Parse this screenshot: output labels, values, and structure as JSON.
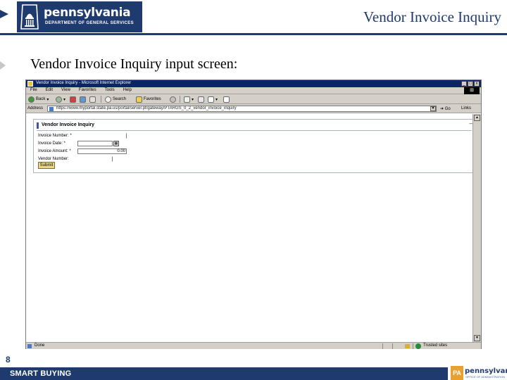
{
  "slide": {
    "logo_word": "pennsylvania",
    "logo_sub": "DEPARTMENT OF GENERAL SERVICES",
    "header_title": "Vendor Invoice Inquiry",
    "subtitle": "Vendor Invoice Inquiry input screen:",
    "page_number": "8",
    "footer_text": "SMART BUYING",
    "footer_logo_mark": "PA",
    "footer_logo_word": "pennsylvania",
    "footer_logo_sub": "OFFICE OF ADMINISTRATION",
    "brand_color": "#1f3a6e"
  },
  "browser": {
    "window_title": "Vendor Invoice Inquiry - Microsoft Internet Explorer",
    "window_buttons": [
      "_",
      "□",
      "x"
    ],
    "menu": [
      "File",
      "Edit",
      "View",
      "Favorites",
      "Tools",
      "Help"
    ],
    "toolbar": {
      "back": "Back",
      "search": "Search",
      "favorites": "Favorites"
    },
    "address_label": "Address",
    "address_url": "https://www.myportal.state.pa.us/portal/server.pt/gateway/PTARGS_0_2_vendor_invoice_inquiry",
    "go_label": "Go",
    "links_label": "Links",
    "status_text": "Done",
    "status_zone": "Trusted sites"
  },
  "portlet": {
    "title": "Vendor Invoice Inquiry",
    "minimize": "–",
    "fields": [
      {
        "label": "Invoice Number: *",
        "value": ""
      },
      {
        "label": "Invoice Date: *",
        "value": ""
      },
      {
        "label": "Invoice Amount: *",
        "value": "0.00"
      },
      {
        "label": "Vendor Number:",
        "value": ""
      }
    ],
    "submit_label": "Submit"
  }
}
